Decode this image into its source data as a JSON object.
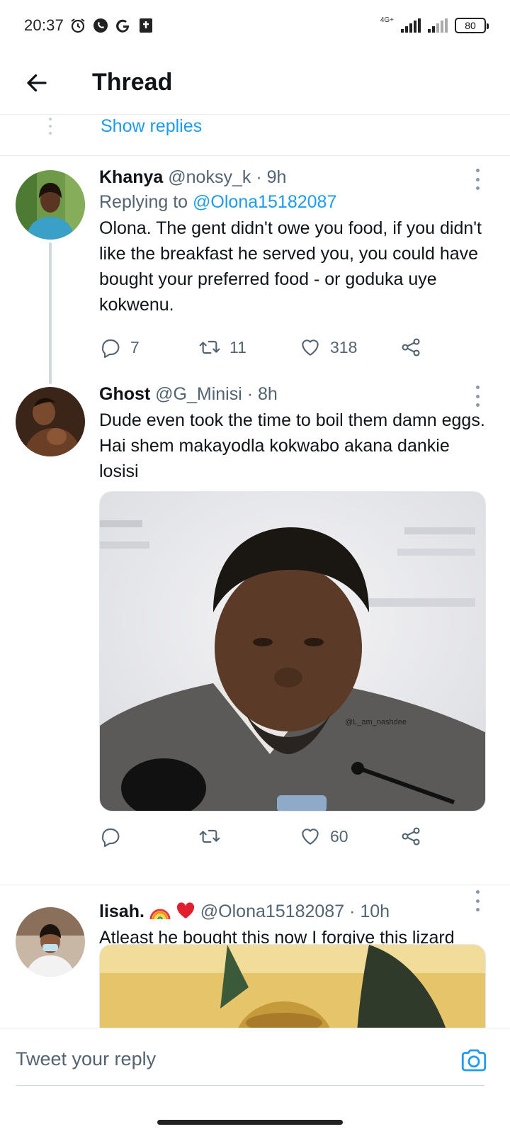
{
  "status_bar": {
    "time": "20:37",
    "network_label": "4G+",
    "battery": "80",
    "icons": [
      "alarm-icon",
      "whatsapp-icon",
      "google-icon",
      "bible-app-icon"
    ]
  },
  "header": {
    "title": "Thread",
    "back_icon": "arrow-left-icon"
  },
  "show_replies": {
    "label": "Show replies"
  },
  "tweets": [
    {
      "name": "Khanya",
      "handle": "@noksy_k",
      "time": "· 9h",
      "replying_prefix": "Replying to",
      "replying_handle": "@Olona15182087",
      "text": "Olona. The gent didn't owe you food, if you didn't like the breakfast he served you, you could have bought your preferred food - or goduka uye kokwenu.",
      "replies": "7",
      "retweets": "11",
      "likes": "318"
    },
    {
      "name": "Ghost",
      "handle": "@G_Minisi",
      "time": "· 8h",
      "text": "Dude even took the time to boil them damn eggs. Hai shem makayodla kokwabo akana dankie losisi",
      "watermark": "@L_am_nashdee",
      "likes": "60"
    },
    {
      "name": "lisah.",
      "handle": "@Olona15182087",
      "time": "· 10h",
      "text": "Atleast he bought this now I forgive this lizard"
    }
  ],
  "reply_bar": {
    "placeholder": "Tweet your reply",
    "camera_icon": "camera-icon"
  },
  "colors": {
    "accent": "#1d9bf0",
    "secondary_text": "#536471",
    "divider": "#e6ecf0"
  }
}
